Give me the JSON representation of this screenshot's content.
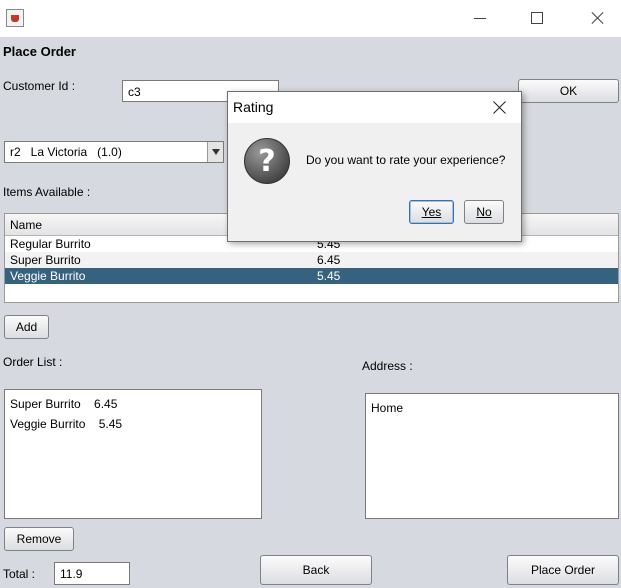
{
  "window": {
    "title": ""
  },
  "form": {
    "heading": "Place Order",
    "customer_label": "Customer Id :",
    "customer_value": "c3",
    "ok_label": "OK",
    "restaurant_selected": "r2   La Victoria   (1.0)",
    "items_label": "Items Available :",
    "items_table": {
      "columns": [
        "Name",
        ""
      ],
      "rows": [
        {
          "name": "Regular Burrito",
          "price": "5.45"
        },
        {
          "name": "Super Burrito",
          "price": "6.45"
        },
        {
          "name": "Veggie Burrito",
          "price": "5.45"
        }
      ],
      "selected_index": 2
    },
    "add_label": "Add",
    "order_list_label": "Order List :",
    "order_list": [
      "Super Burrito    6.45",
      "Veggie Burrito    5.45"
    ],
    "address_label": "Address :",
    "address_value": "Home",
    "remove_label": "Remove",
    "total_label": "Total :",
    "total_value": "11.9",
    "back_label": "Back",
    "place_order_label": "Place Order"
  },
  "dialog": {
    "title": "Rating",
    "message": "Do you want to rate your experience?",
    "yes_label": "Yes",
    "no_label": "No"
  },
  "colors": {
    "background": "#d6d9df",
    "selection": "#36617f"
  }
}
